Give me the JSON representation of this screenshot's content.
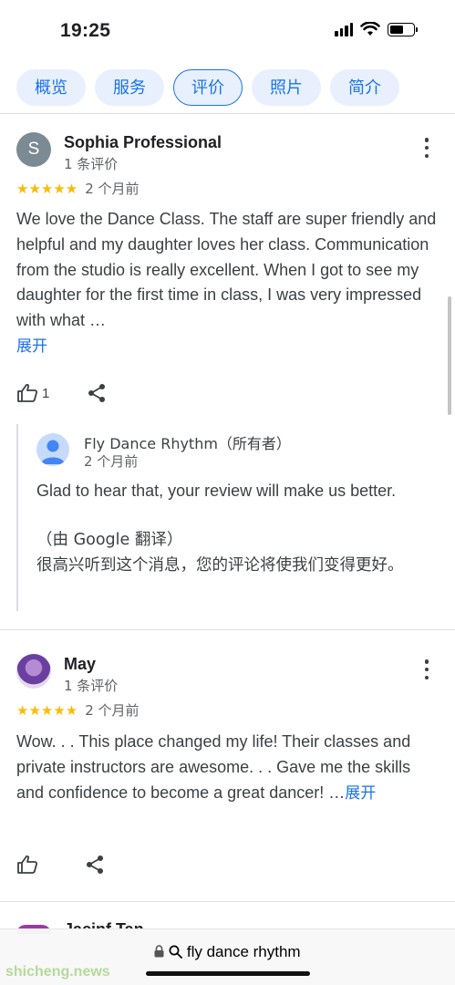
{
  "status_bar": {
    "time": "19:25"
  },
  "tabs": [
    {
      "label": "概览",
      "active": false
    },
    {
      "label": "服务",
      "active": false
    },
    {
      "label": "评价",
      "active": true
    },
    {
      "label": "照片",
      "active": false
    },
    {
      "label": "简介",
      "active": false
    }
  ],
  "reviews": [
    {
      "avatar_initial": "S",
      "name": "Sophia Professional",
      "review_count": "1 条评价",
      "stars": "★★★★★",
      "rating": 5,
      "time": "2 个月前",
      "text": "We love the Dance Class. The staff are super friendly and helpful and my daughter loves her class. Communication from the studio is really excellent. When I got to see my daughter for the first time in class, I was very impressed with what …",
      "expand_label": "展开",
      "like_count": "1",
      "owner_reply": {
        "name": "Fly Dance Rhythm（所有者）",
        "time": "2 个月前",
        "text": "Glad to hear that, your review will make us better.",
        "translation_note": "（由 Google 翻译）",
        "translation": "很高兴听到这个消息，您的评论将使我们变得更好。"
      }
    },
    {
      "name": "May",
      "review_count": "1 条评价",
      "stars": "★★★★★",
      "rating": 5,
      "time": "2 个月前",
      "text": "Wow. . . This place changed my life! Their classes and private instructors are awesome. . . Gave me the skills and confidence to become a great dancer! …",
      "expand_label": "展开"
    }
  ],
  "next_reviewer_peek": "Jacinf Tan",
  "address_bar": {
    "url": "fly dance rhythm"
  },
  "watermark": "shicheng.news",
  "colors": {
    "accent": "#1a73e8",
    "star": "#fbbc04",
    "tab_bg": "#e8f0fe"
  }
}
